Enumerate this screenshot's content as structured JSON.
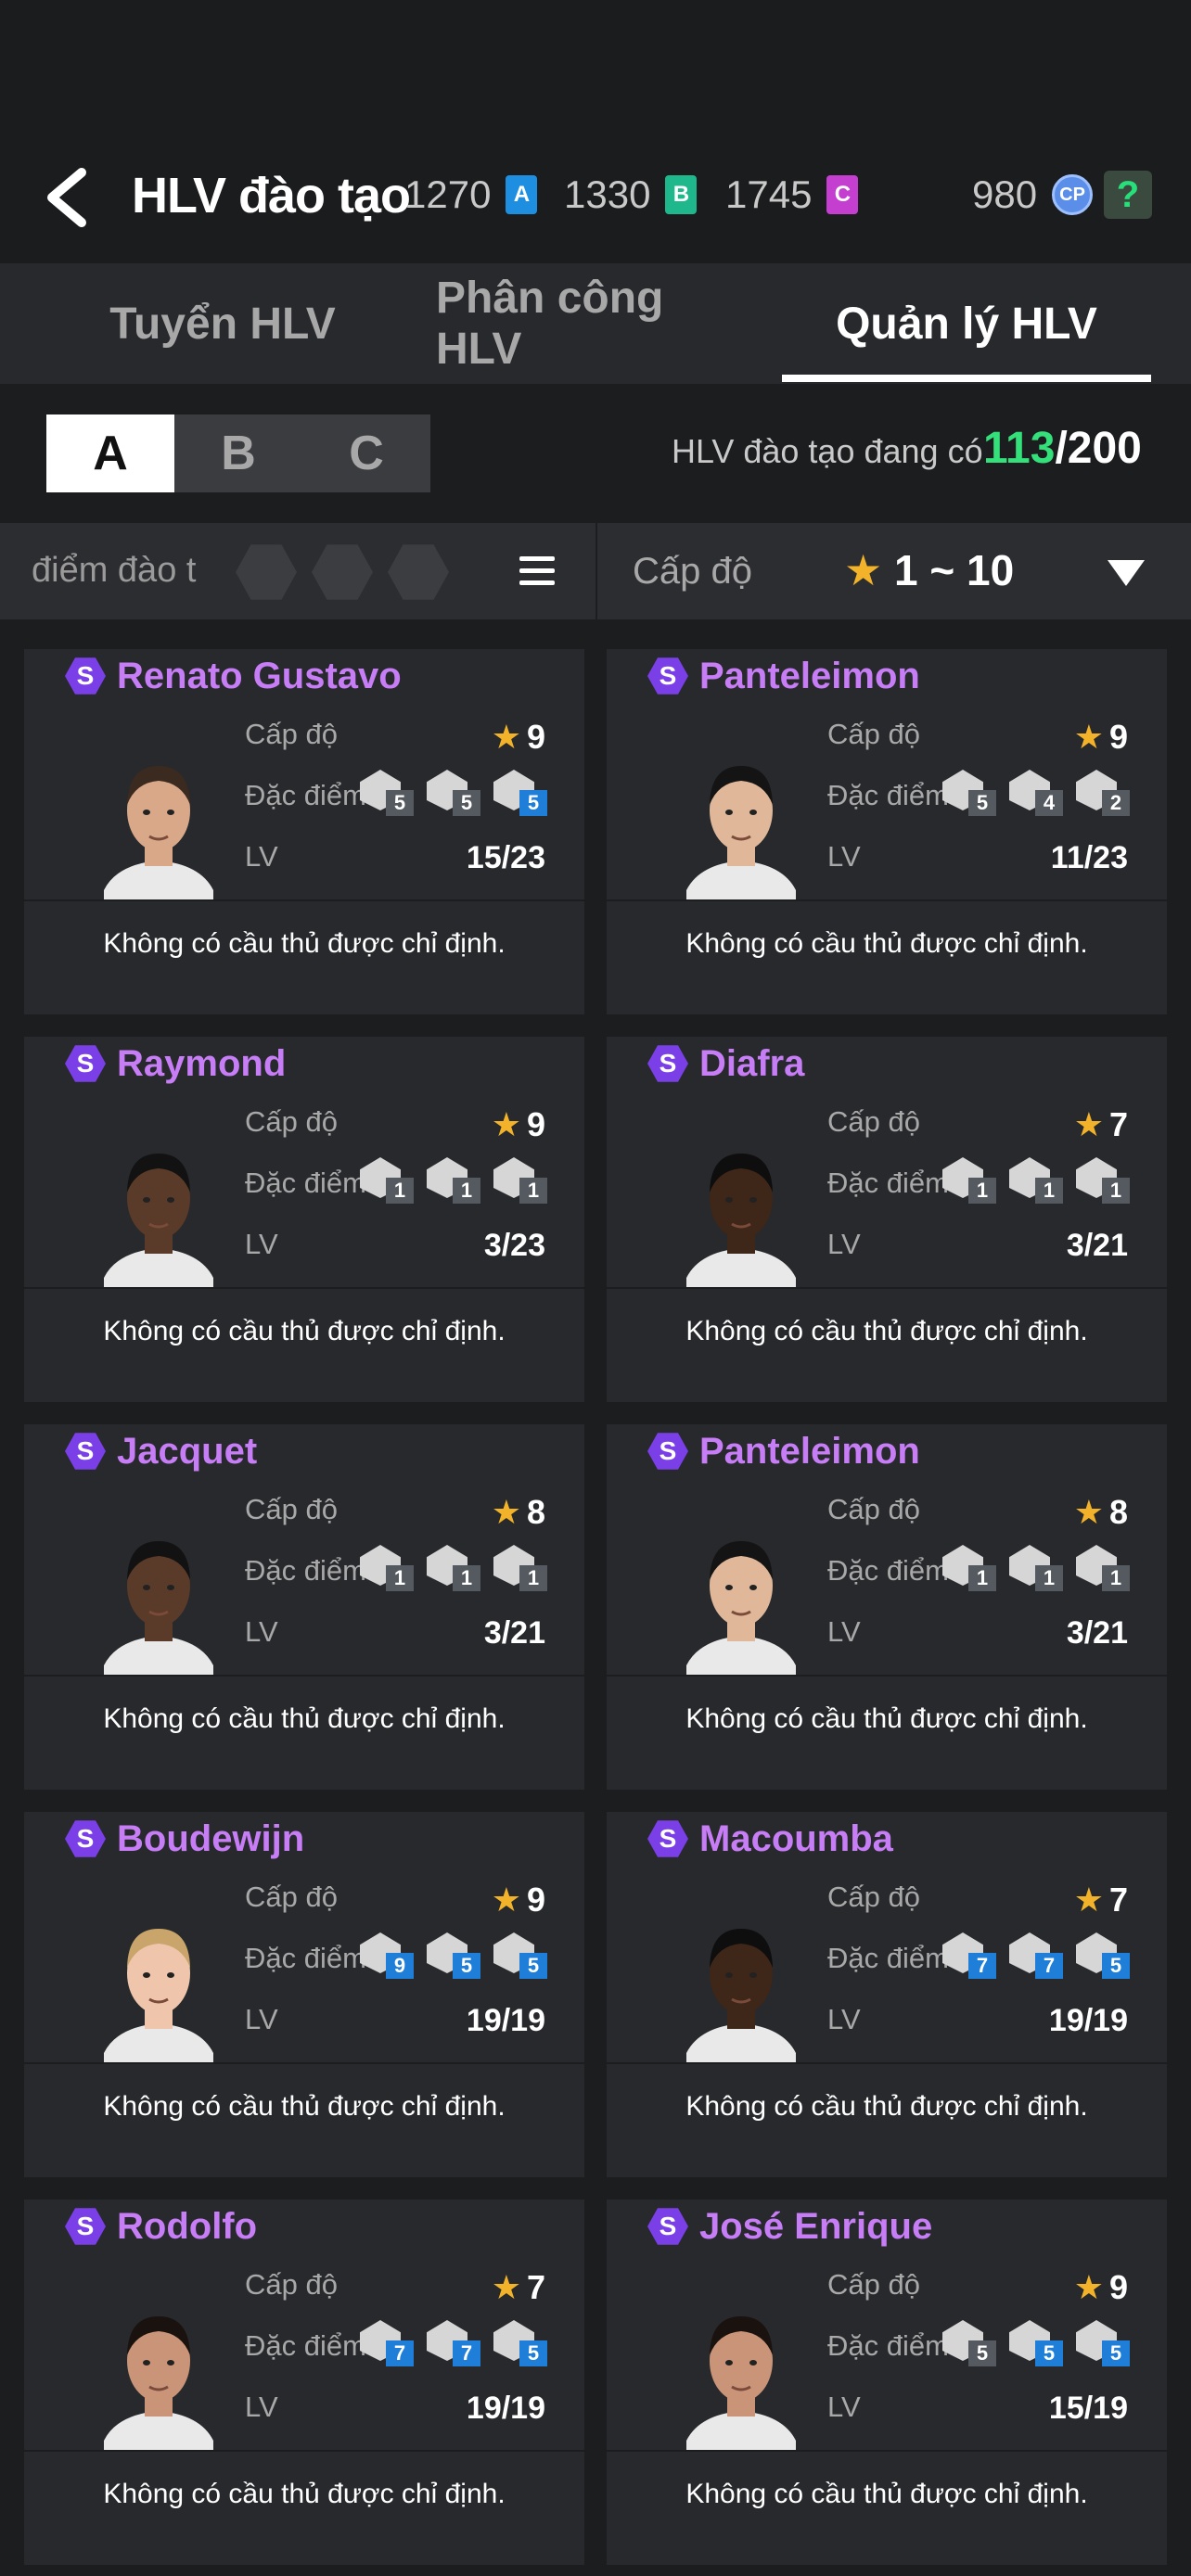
{
  "header": {
    "title": "HLV đào tạo",
    "currencies": [
      {
        "value": "1270",
        "badge": "A",
        "color": "#1e8fe0"
      },
      {
        "value": "1330",
        "badge": "B",
        "color": "#1fb88c"
      },
      {
        "value": "1745",
        "badge": "C",
        "color": "#c43fd0"
      }
    ],
    "cp_value": "980",
    "cp_badge": "CP",
    "help": "?"
  },
  "tabs": [
    {
      "label": "Tuyển HLV"
    },
    {
      "label": "Phân công HLV"
    },
    {
      "label": "Quản lý HLV"
    }
  ],
  "segment": [
    "A",
    "B",
    "C"
  ],
  "count": {
    "label": "HLV đào tạo đang có",
    "current": "113",
    "max": "/200"
  },
  "filter": {
    "sort_label": "điểm đào t",
    "level_label": "Cấp độ",
    "level_star": "★",
    "level_range": " 1 ~ 10"
  },
  "card_labels": {
    "level": "Cấp độ",
    "traits": "Đặc điểm",
    "lv": "LV",
    "note": "Không có cầu thủ được chỉ định.",
    "rarity": "S"
  },
  "coaches": [
    {
      "name": "Renato Gustavo",
      "level": "9",
      "lv": "15/23",
      "traits": [
        {
          "n": "5",
          "blue": false
        },
        {
          "n": "5",
          "blue": false
        },
        {
          "n": "5",
          "blue": true
        }
      ],
      "skin": "#d9a889",
      "hair": "#3a2a20"
    },
    {
      "name": "Panteleimon",
      "level": "9",
      "lv": "11/23",
      "traits": [
        {
          "n": "5",
          "blue": false
        },
        {
          "n": "4",
          "blue": false
        },
        {
          "n": "2",
          "blue": false
        }
      ],
      "skin": "#e0b899",
      "hair": "#141414"
    },
    {
      "name": "Raymond",
      "level": "9",
      "lv": "3/23",
      "traits": [
        {
          "n": "1",
          "blue": false
        },
        {
          "n": "1",
          "blue": false
        },
        {
          "n": "1",
          "blue": false
        }
      ],
      "skin": "#5a3a28",
      "hair": "#121212"
    },
    {
      "name": "Diafra",
      "level": "7",
      "lv": "3/21",
      "traits": [
        {
          "n": "1",
          "blue": false
        },
        {
          "n": "1",
          "blue": false
        },
        {
          "n": "1",
          "blue": false
        }
      ],
      "skin": "#3e2618",
      "hair": "#0e0e0e"
    },
    {
      "name": "Jacquet",
      "level": "8",
      "lv": "3/21",
      "traits": [
        {
          "n": "1",
          "blue": false
        },
        {
          "n": "1",
          "blue": false
        },
        {
          "n": "1",
          "blue": false
        }
      ],
      "skin": "#5a3a28",
      "hair": "#121212"
    },
    {
      "name": "Panteleimon",
      "level": "8",
      "lv": "3/21",
      "traits": [
        {
          "n": "1",
          "blue": false
        },
        {
          "n": "1",
          "blue": false
        },
        {
          "n": "1",
          "blue": false
        }
      ],
      "skin": "#e0b899",
      "hair": "#141414"
    },
    {
      "name": "Boudewijn",
      "level": "9",
      "lv": "19/19",
      "traits": [
        {
          "n": "9",
          "blue": true
        },
        {
          "n": "5",
          "blue": true
        },
        {
          "n": "5",
          "blue": true
        }
      ],
      "skin": "#efc6ab",
      "hair": "#c9a56b"
    },
    {
      "name": "Macoumba",
      "level": "7",
      "lv": "19/19",
      "traits": [
        {
          "n": "7",
          "blue": true
        },
        {
          "n": "7",
          "blue": true
        },
        {
          "n": "5",
          "blue": true
        }
      ],
      "skin": "#3e2618",
      "hair": "#0e0e0e"
    },
    {
      "name": "Rodolfo",
      "level": "7",
      "lv": "19/19",
      "traits": [
        {
          "n": "7",
          "blue": true
        },
        {
          "n": "7",
          "blue": true
        },
        {
          "n": "5",
          "blue": true
        }
      ],
      "skin": "#c99477",
      "hair": "#1a120e"
    },
    {
      "name": "José Enrique",
      "level": "9",
      "lv": "15/19",
      "traits": [
        {
          "n": "5",
          "blue": false
        },
        {
          "n": "5",
          "blue": true
        },
        {
          "n": "5",
          "blue": true
        }
      ],
      "skin": "#c99477",
      "hair": "#1a120e"
    }
  ]
}
